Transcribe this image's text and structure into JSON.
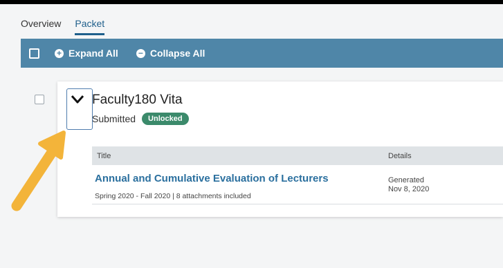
{
  "tabs": [
    {
      "label": "Overview",
      "active": false
    },
    {
      "label": "Packet",
      "active": true
    }
  ],
  "action_bar": {
    "expand_label": "Expand All",
    "collapse_label": "Collapse All",
    "color": "#4f86a8"
  },
  "item": {
    "title": "Faculty180 Vita",
    "status": "Submitted",
    "badge": "Unlocked",
    "badge_color": "#3b8a6b"
  },
  "table": {
    "headers": [
      "Title",
      "Details"
    ],
    "rows": [
      {
        "title": "Annual and Cumulative Evaluation of Lecturers",
        "meta": "Spring 2020 - Fall 2020 | 8 attachments included",
        "details_line1": "Generated",
        "details_line2": "Nov 8, 2020"
      }
    ]
  },
  "annotation": {
    "arrow_color": "#f3b43a"
  }
}
